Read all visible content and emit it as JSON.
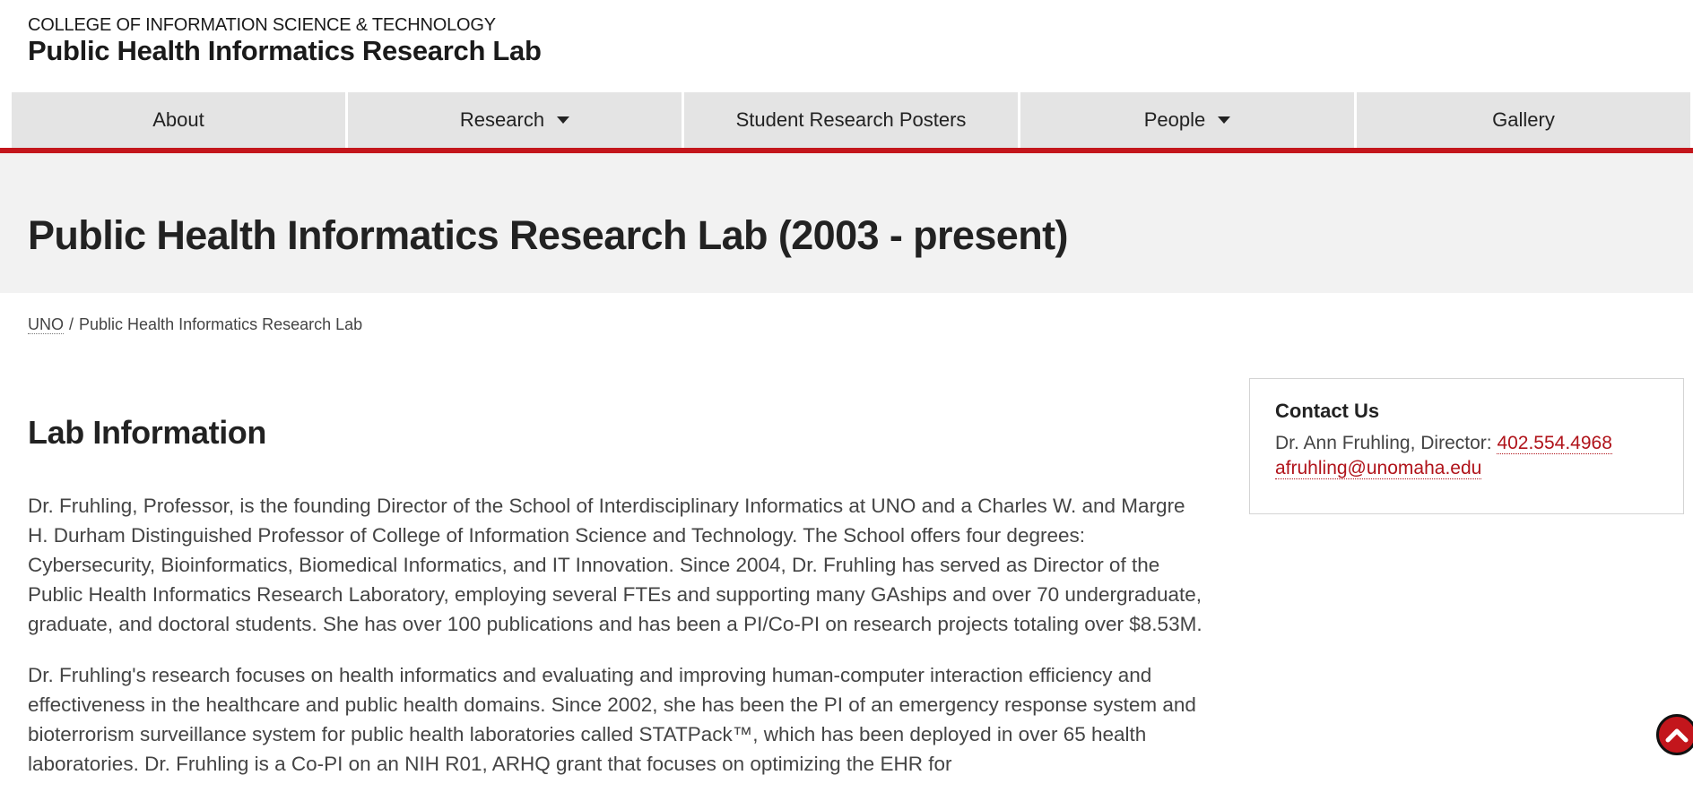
{
  "header": {
    "college": "COLLEGE OF INFORMATION SCIENCE & TECHNOLOGY",
    "lab_title": "Public Health Informatics Research Lab"
  },
  "nav": {
    "items": [
      {
        "label": "About",
        "dropdown": false
      },
      {
        "label": "Research",
        "dropdown": true
      },
      {
        "label": "Student Research Posters",
        "dropdown": false
      },
      {
        "label": "People",
        "dropdown": true
      },
      {
        "label": "Gallery",
        "dropdown": false
      }
    ]
  },
  "page": {
    "title": "Public Health Informatics Research Lab (2003 - present)"
  },
  "breadcrumb": {
    "home": "UNO",
    "separator": "/",
    "current": "Public Health Informatics Research Lab"
  },
  "main": {
    "section_title": "Lab Information",
    "paragraphs": [
      "Dr. Fruhling, Professor, is the founding Director of the School of Interdisciplinary Informatics at UNO and a Charles W. and Margre H. Durham Distinguished Professor of College of Information Science and Technology. The School offers four degrees: Cybersecurity, Bioinformatics, Biomedical Informatics, and IT Innovation.  Since 2004, Dr. Fruhling has served as Director of the Public Health Informatics Research Laboratory, employing several FTEs and supporting many GAships and over 70 undergraduate, graduate, and doctoral students.  She has over 100 publications and has been a PI/Co-PI on research projects totaling over $8.53M.",
      "Dr. Fruhling's research focuses on health informatics and evaluating and improving human-computer interaction efficiency and effectiveness in the healthcare and public health domains.  Since 2002, she has been the PI of an emergency response system and bioterrorism surveillance system for public health laboratories called STATPack™, which has been deployed in over 65 health laboratories. Dr. Fruhling is a Co-PI on an NIH R01, ARHQ grant that focuses on optimizing the EHR for"
    ]
  },
  "contact": {
    "title": "Contact Us",
    "director_label": "Dr. Ann Fruhling, Director: ",
    "phone": "402.554.4968",
    "email": "afruhling@unomaha.edu"
  },
  "colors": {
    "accent": "#c3161c",
    "nav_bg": "#e4e4e4",
    "band_bg": "#f2f2f2",
    "link": "#b0131a"
  },
  "icons": {
    "dropdown": "caret-down-icon",
    "back_to_top": "chevron-up-icon"
  }
}
